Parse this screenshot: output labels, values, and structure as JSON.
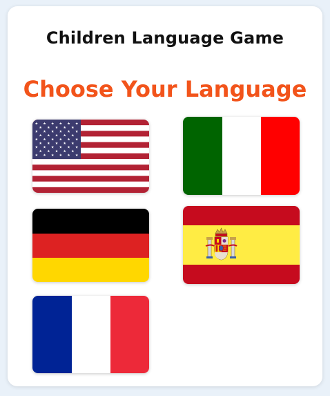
{
  "app": {
    "title": "Children Language Game",
    "heading": "Choose Your Language"
  },
  "colors": {
    "heading": "#f2541b",
    "background": "#e9f1f9",
    "card": "#ffffff"
  },
  "flags": [
    {
      "icon": "us-flag-icon",
      "colors": [
        "#b22234",
        "#ffffff",
        "#3c3b6e"
      ]
    },
    {
      "icon": "italy-flag-icon",
      "colors": [
        "#006400",
        "#ffffff",
        "#ff0000"
      ]
    },
    {
      "icon": "germany-flag-icon",
      "colors": [
        "#000000",
        "#dd2222",
        "#ffd700"
      ]
    },
    {
      "icon": "spain-flag-icon",
      "colors": [
        "#c60b1e",
        "#ffec44",
        "#c60b1e"
      ]
    },
    {
      "icon": "france-flag-icon",
      "colors": [
        "#002395",
        "#ffffff",
        "#ed2939"
      ]
    }
  ]
}
